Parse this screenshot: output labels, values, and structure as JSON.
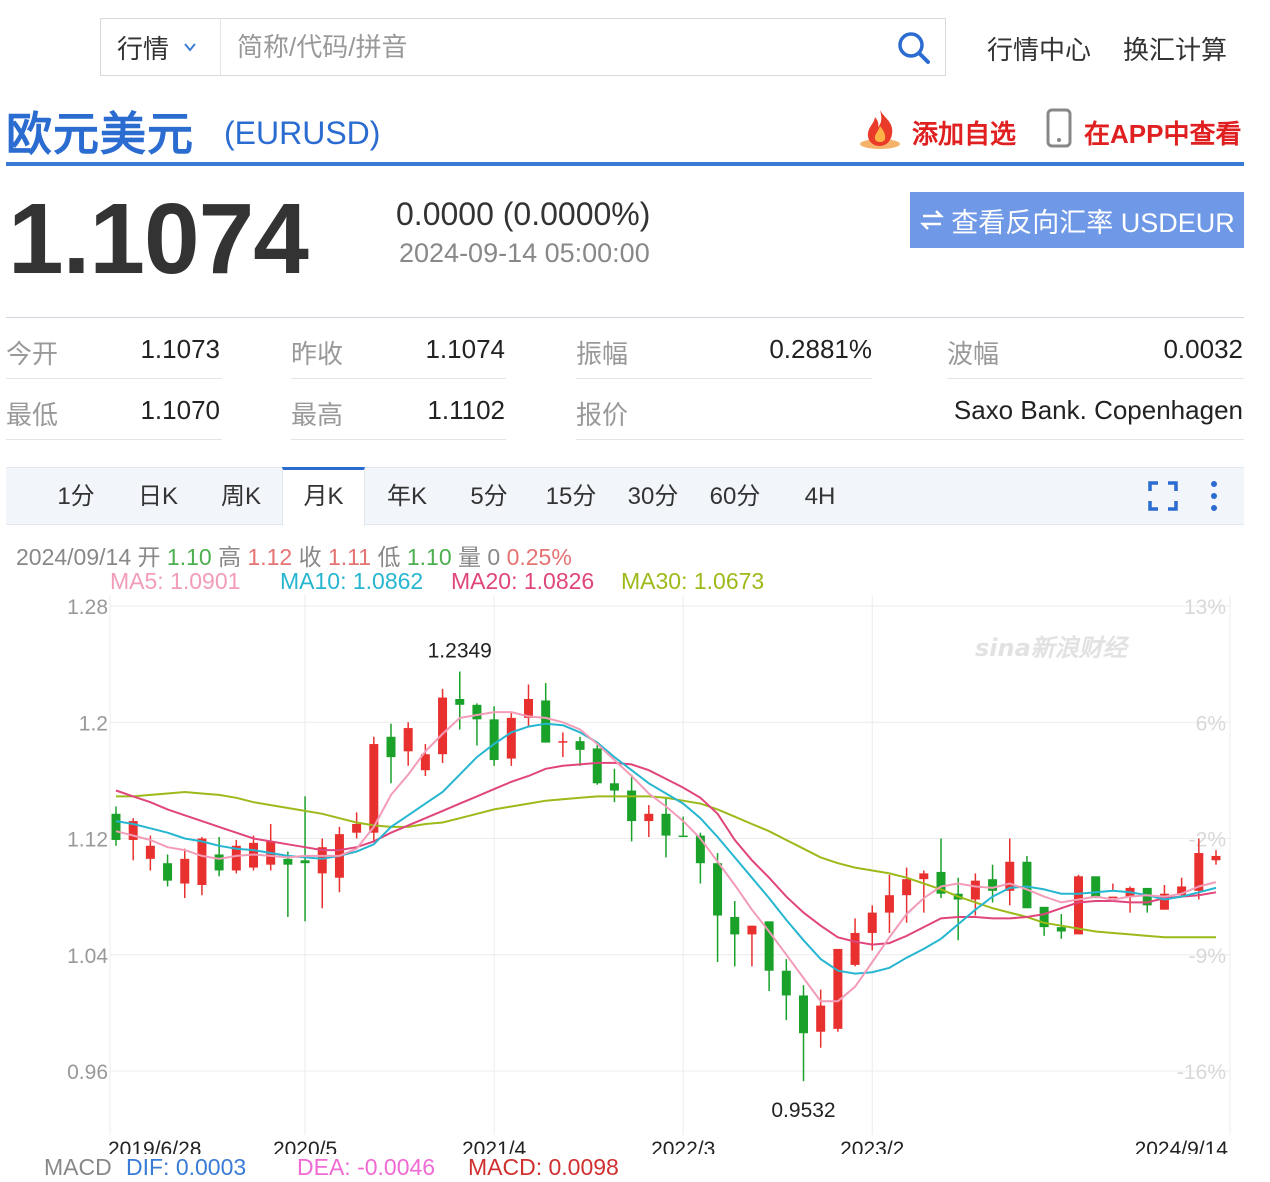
{
  "search": {
    "market_label": "行情",
    "placeholder": "简称/代码/拼音"
  },
  "top_links": [
    "行情中心",
    "换汇计算"
  ],
  "header": {
    "title": "欧元美元",
    "symbol": "(EURUSD)",
    "add_favorite": "添加自选",
    "view_in_app": "在APP中查看"
  },
  "quote": {
    "price": "1.1074",
    "change": "0.0000 (0.0000%)",
    "datetime": "2024-09-14 05:00:00",
    "reverse_button": "查看反向汇率 USDEUR"
  },
  "stats": [
    {
      "label": "今开",
      "value": "1.1073"
    },
    {
      "label": "昨收",
      "value": "1.1074"
    },
    {
      "label": "振幅",
      "value": "0.2881%"
    },
    {
      "label": "波幅",
      "value": "0.0032"
    },
    {
      "label": "最低",
      "value": "1.1070"
    },
    {
      "label": "最高",
      "value": "1.1102"
    },
    {
      "label": "报价",
      "value": "Saxo Bank. Copenhagen"
    }
  ],
  "tabs": [
    "1分",
    "日K",
    "周K",
    "月K",
    "年K",
    "5分",
    "15分",
    "30分",
    "60分",
    "4H"
  ],
  "active_tab": "月K",
  "candle_info": {
    "date": "2024/09/14",
    "open_label": "开",
    "open": "1.10",
    "high_label": "高",
    "high": "1.12",
    "close_label": "收",
    "close": "1.11",
    "low_label": "低",
    "low": "1.10",
    "volume_label": "量",
    "volume": "0",
    "change_pct": "0.25%"
  },
  "ma": [
    {
      "label": "MA5: 1.0901",
      "color": "#f29cb8"
    },
    {
      "label": "MA10: 1.0862",
      "color": "#26b6d0"
    },
    {
      "label": "MA20: 1.0826",
      "color": "#e0457b"
    },
    {
      "label": "MA30: 1.0673",
      "color": "#9cba1a"
    }
  ],
  "macd": {
    "label": "MACD",
    "dif": "DIF: 0.0003",
    "dif_color": "#3a7bd5",
    "dea": "DEA: -0.0046",
    "dea_color": "#f06ad4",
    "macd": "MACD: 0.0098",
    "macd_color": "#d03030"
  },
  "chart_data": {
    "type": "candlestick",
    "ylim": [
      0.94,
      1.29
    ],
    "y_ticks": [
      "1.28",
      "1.2",
      "1.12",
      "1.04",
      "0.96"
    ],
    "y_tick_values": [
      1.28,
      1.2,
      1.12,
      1.04,
      0.96
    ],
    "pct_ticks": [
      "13%",
      "6%",
      "-2%",
      "-9%",
      "-16%"
    ],
    "pct_tick_values": [
      1.28,
      1.2,
      1.12,
      1.04,
      0.96
    ],
    "x_labels": [
      "2019/6/28",
      "2020/5",
      "2021/4",
      "2022/3",
      "2023/2",
      "2024/9/14"
    ],
    "x_label_index": [
      0,
      11,
      22,
      33,
      44,
      63
    ],
    "annotations": [
      {
        "text": "1.2349",
        "index": 20,
        "value": 1.2349
      },
      {
        "text": "0.9532",
        "index": 40,
        "value": 0.9532
      }
    ],
    "watermark": "sina新浪财经",
    "candles": [
      [
        1.137,
        1.119,
        1.142,
        1.115
      ],
      [
        1.119,
        1.132,
        1.134,
        1.105
      ],
      [
        1.106,
        1.115,
        1.122,
        1.098
      ],
      [
        1.103,
        1.091,
        1.109,
        1.087
      ],
      [
        1.089,
        1.106,
        1.113,
        1.079
      ],
      [
        1.088,
        1.12,
        1.121,
        1.081
      ],
      [
        1.109,
        1.098,
        1.121,
        1.094
      ],
      [
        1.098,
        1.115,
        1.119,
        1.096
      ],
      [
        1.1,
        1.117,
        1.122,
        1.098
      ],
      [
        1.102,
        1.118,
        1.13,
        1.098
      ],
      [
        1.106,
        1.102,
        1.111,
        1.066
      ],
      [
        1.105,
        1.103,
        1.149,
        1.063
      ],
      [
        1.096,
        1.114,
        1.12,
        1.072
      ],
      [
        1.093,
        1.123,
        1.128,
        1.083
      ],
      [
        1.124,
        1.13,
        1.138,
        1.12
      ],
      [
        1.124,
        1.185,
        1.19,
        1.118
      ],
      [
        1.19,
        1.176,
        1.199,
        1.158
      ],
      [
        1.18,
        1.196,
        1.2,
        1.17
      ],
      [
        1.167,
        1.178,
        1.185,
        1.163
      ],
      [
        1.178,
        1.217,
        1.223,
        1.172
      ],
      [
        1.216,
        1.212,
        1.2349,
        1.195
      ],
      [
        1.212,
        1.202,
        1.213,
        1.184
      ],
      [
        1.202,
        1.174,
        1.211,
        1.17
      ],
      [
        1.175,
        1.203,
        1.207,
        1.17
      ],
      [
        1.203,
        1.216,
        1.226,
        1.197
      ],
      [
        1.215,
        1.186,
        1.227,
        1.186
      ],
      [
        1.186,
        1.187,
        1.193,
        1.176
      ],
      [
        1.187,
        1.181,
        1.19,
        1.17
      ],
      [
        1.182,
        1.158,
        1.185,
        1.157
      ],
      [
        1.158,
        1.153,
        1.168,
        1.145
      ],
      [
        1.153,
        1.132,
        1.164,
        1.118
      ],
      [
        1.132,
        1.137,
        1.143,
        1.121
      ],
      [
        1.137,
        1.122,
        1.148,
        1.107
      ],
      [
        1.122,
        1.121,
        1.135,
        1.122
      ],
      [
        1.122,
        1.103,
        1.124,
        1.089
      ],
      [
        1.103,
        1.067,
        1.11,
        1.035
      ],
      [
        1.066,
        1.054,
        1.077,
        1.032
      ],
      [
        1.054,
        1.06,
        1.06,
        1.032
      ],
      [
        1.063,
        1.029,
        1.041,
        1.015
      ],
      [
        1.029,
        1.012,
        1.037,
        0.995
      ],
      [
        1.012,
        0.986,
        1.019,
        0.953
      ],
      [
        0.987,
        1.005,
        1.016,
        0.976
      ],
      [
        0.989,
        1.044,
        1.044,
        0.987
      ],
      [
        1.033,
        1.055,
        1.065,
        1.032
      ],
      [
        1.055,
        1.069,
        1.074,
        1.043
      ],
      [
        1.069,
        1.081,
        1.095,
        1.055
      ],
      [
        1.081,
        1.092,
        1.1,
        1.062
      ],
      [
        1.092,
        1.096,
        1.098,
        1.069
      ],
      [
        1.097,
        1.082,
        1.12,
        1.079
      ],
      [
        1.082,
        1.078,
        1.093,
        1.05
      ],
      [
        1.078,
        1.091,
        1.096,
        1.067
      ],
      [
        1.092,
        1.084,
        1.102,
        1.076
      ],
      [
        1.084,
        1.104,
        1.12,
        1.074
      ],
      [
        1.104,
        1.072,
        1.108,
        1.072
      ],
      [
        1.073,
        1.059,
        1.067,
        1.053
      ],
      [
        1.059,
        1.056,
        1.068,
        1.051
      ],
      [
        1.054,
        1.094,
        1.095,
        1.065
      ],
      [
        1.094,
        1.079,
        1.093,
        1.083
      ],
      [
        1.079,
        1.08,
        1.089,
        1.084
      ],
      [
        1.08,
        1.086,
        1.087,
        1.069
      ],
      [
        1.086,
        1.074,
        1.08,
        1.069
      ],
      [
        1.071,
        1.082,
        1.088,
        1.071
      ],
      [
        1.081,
        1.087,
        1.093,
        1.08
      ],
      [
        1.084,
        1.11,
        1.12,
        1.078
      ],
      [
        1.105,
        1.108,
        1.112,
        1.102
      ]
    ],
    "ma5": [
      1.125,
      1.122,
      1.119,
      1.114,
      1.112,
      1.108,
      1.106,
      1.108,
      1.109,
      1.108,
      1.107,
      1.108,
      1.108,
      1.108,
      1.113,
      1.128,
      1.15,
      1.164,
      1.18,
      1.192,
      1.203,
      1.205,
      1.207,
      1.207,
      1.204,
      1.203,
      1.2,
      1.195,
      1.185,
      1.174,
      1.163,
      1.151,
      1.142,
      1.132,
      1.12,
      1.104,
      1.088,
      1.071,
      1.056,
      1.04,
      1.024,
      1.008,
      1.008,
      1.018,
      1.035,
      1.052,
      1.068,
      1.079,
      1.087,
      1.089,
      1.087,
      1.086,
      1.089,
      1.085,
      1.08,
      1.076,
      1.078,
      1.08,
      1.078,
      1.08,
      1.081,
      1.08,
      1.082,
      1.087,
      1.09
    ],
    "ma10": [
      1.132,
      1.13,
      1.127,
      1.124,
      1.12,
      1.118,
      1.115,
      1.113,
      1.112,
      1.11,
      1.108,
      1.107,
      1.106,
      1.108,
      1.111,
      1.116,
      1.128,
      1.136,
      1.144,
      1.152,
      1.164,
      1.176,
      1.185,
      1.193,
      1.197,
      1.199,
      1.198,
      1.193,
      1.186,
      1.176,
      1.167,
      1.158,
      1.151,
      1.144,
      1.134,
      1.121,
      1.107,
      1.093,
      1.079,
      1.064,
      1.05,
      1.037,
      1.029,
      1.027,
      1.028,
      1.031,
      1.038,
      1.044,
      1.051,
      1.061,
      1.071,
      1.08,
      1.086,
      1.087,
      1.085,
      1.082,
      1.082,
      1.083,
      1.084,
      1.083,
      1.081,
      1.078,
      1.08,
      1.083,
      1.086
    ],
    "ma20": [
      1.153,
      1.149,
      1.145,
      1.14,
      1.136,
      1.132,
      1.128,
      1.124,
      1.12,
      1.118,
      1.116,
      1.114,
      1.112,
      1.112,
      1.114,
      1.118,
      1.124,
      1.129,
      1.134,
      1.139,
      1.144,
      1.149,
      1.154,
      1.159,
      1.163,
      1.168,
      1.17,
      1.171,
      1.172,
      1.172,
      1.171,
      1.167,
      1.161,
      1.155,
      1.148,
      1.137,
      1.119,
      1.105,
      1.093,
      1.08,
      1.069,
      1.06,
      1.052,
      1.049,
      1.047,
      1.048,
      1.053,
      1.059,
      1.065,
      1.066,
      1.066,
      1.065,
      1.065,
      1.066,
      1.068,
      1.072,
      1.076,
      1.077,
      1.077,
      1.076,
      1.076,
      1.079,
      1.08,
      1.081,
      1.083
    ],
    "ma30": [
      1.149,
      1.149,
      1.15,
      1.151,
      1.152,
      1.151,
      1.15,
      1.148,
      1.145,
      1.143,
      1.141,
      1.139,
      1.137,
      1.134,
      1.131,
      1.129,
      1.128,
      1.128,
      1.13,
      1.131,
      1.134,
      1.137,
      1.14,
      1.142,
      1.144,
      1.146,
      1.147,
      1.148,
      1.149,
      1.149,
      1.149,
      1.149,
      1.148,
      1.146,
      1.144,
      1.14,
      1.135,
      1.13,
      1.125,
      1.119,
      1.113,
      1.107,
      1.103,
      1.1,
      1.098,
      1.096,
      1.093,
      1.089,
      1.085,
      1.08,
      1.076,
      1.072,
      1.069,
      1.066,
      1.062,
      1.06,
      1.058,
      1.056,
      1.055,
      1.054,
      1.053,
      1.052,
      1.052,
      1.052,
      1.052
    ]
  }
}
